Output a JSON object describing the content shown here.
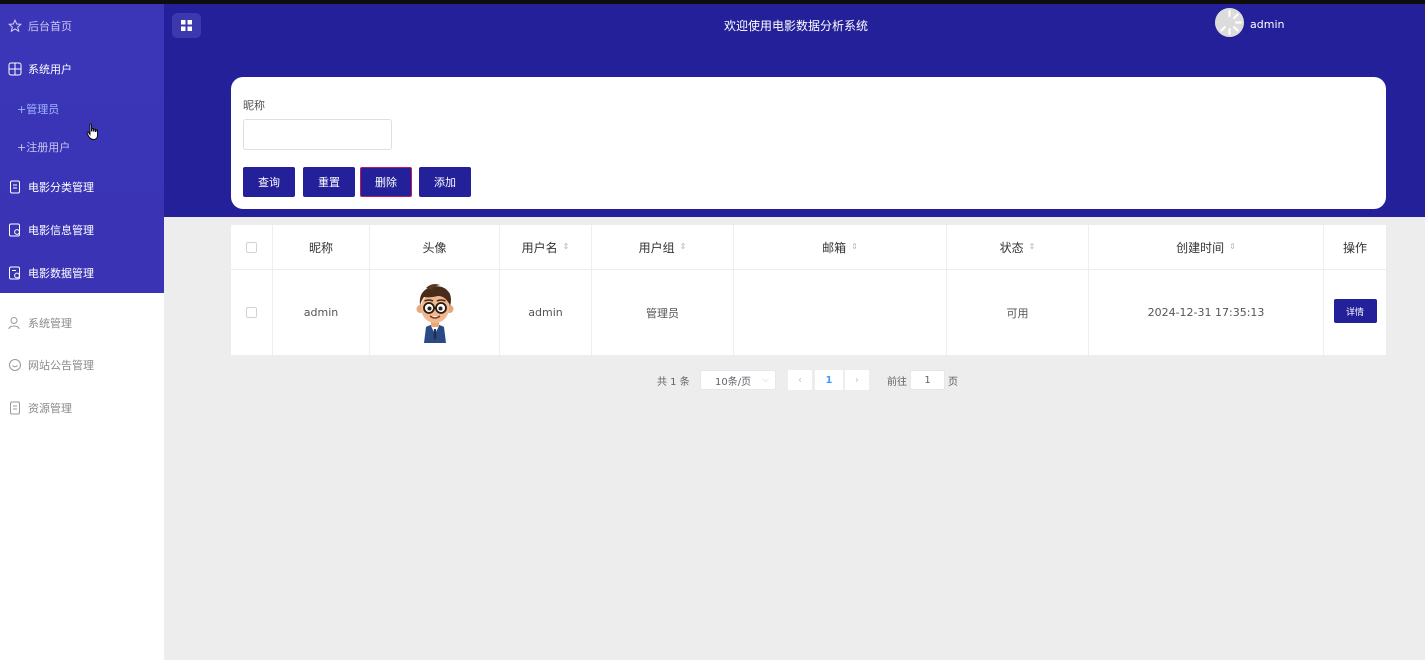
{
  "header": {
    "title": "欢迎使用电影数据分析系统",
    "username": "admin"
  },
  "sidebar": {
    "home": "后台首页",
    "system_users": "系统用户",
    "admin_sub": "+管理员",
    "registered_sub": "+注册用户",
    "movie_category": "电影分类管理",
    "movie_info": "电影信息管理",
    "movie_data": "电影数据管理",
    "system_manage": "系统管理",
    "site_notice": "网站公告管理",
    "resource_manage": "资源管理"
  },
  "search": {
    "nickname_label": "昵称",
    "nickname_value": "",
    "query_button": "查询",
    "reset_button": "重置",
    "delete_button": "删除",
    "add_button": "添加"
  },
  "table": {
    "headers": {
      "nickname": "昵称",
      "avatar": "头像",
      "username": "用户名",
      "user_group": "用户组",
      "email": "邮箱",
      "status": "状态",
      "created_at": "创建时间",
      "actions": "操作"
    },
    "rows": [
      {
        "nickname": "admin",
        "username": "admin",
        "user_group": "管理员",
        "email": "",
        "status": "可用",
        "created_at": "2024-12-31 17:35:13",
        "detail_button": "详情"
      }
    ]
  },
  "pagination": {
    "total_text": "共 1 条",
    "page_size": "10条/页",
    "current_page": "1",
    "goto_label": "前往",
    "goto_value": "1",
    "page_suffix": "页"
  },
  "colors": {
    "primary": "#23209a",
    "sidebar_top": "#3b35b8",
    "background": "#ededed"
  }
}
